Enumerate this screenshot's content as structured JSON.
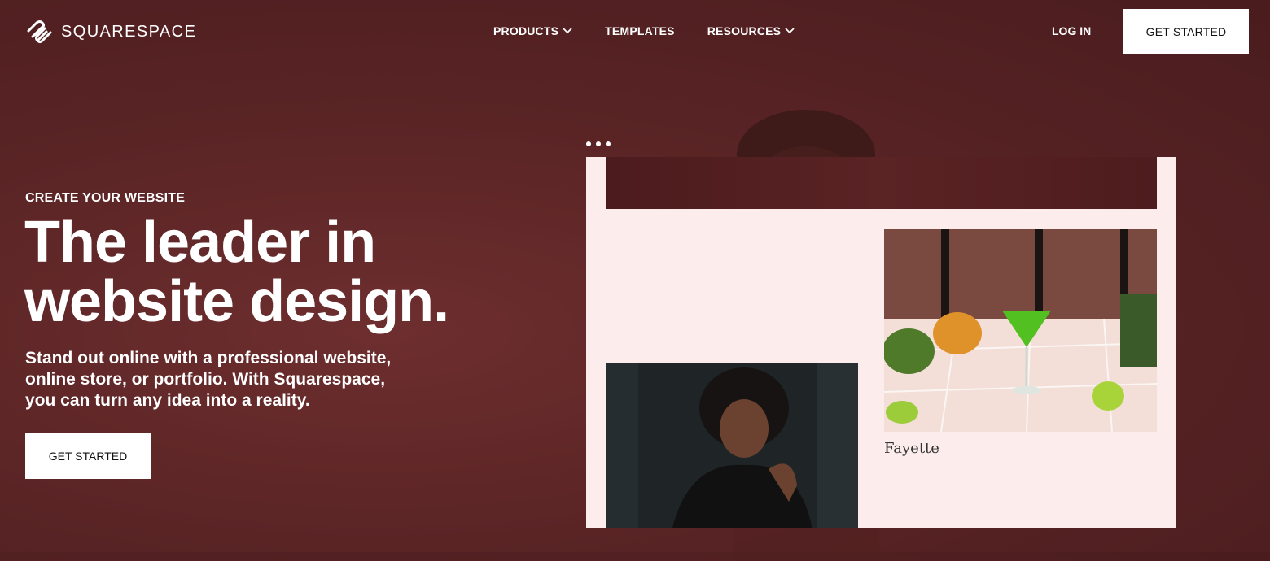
{
  "header": {
    "logo_text": "SQUARESPACE",
    "nav": [
      {
        "label": "PRODUCTS",
        "has_dropdown": true
      },
      {
        "label": "TEMPLATES",
        "has_dropdown": false
      },
      {
        "label": "RESOURCES",
        "has_dropdown": true
      }
    ],
    "login_label": "LOG IN",
    "cta_label": "GET STARTED"
  },
  "hero": {
    "eyebrow": "CREATE YOUR WEBSITE",
    "headline_line1": "The leader in",
    "headline_line2": "website design.",
    "subtext": "Stand out online with a professional website, online store, or portfolio. With Squarespace, you can turn any idea into a reality.",
    "cta_label": "GET STARTED"
  },
  "mockup": {
    "caption": "Fayette",
    "icons": [
      "squarespace-logo-icon",
      "chevron-down-icon",
      "browser-dots-icon"
    ]
  },
  "colors": {
    "background": "#5a2425",
    "button_bg": "#ffffff",
    "button_text": "#111111",
    "mock_bg": "#fdecec"
  }
}
